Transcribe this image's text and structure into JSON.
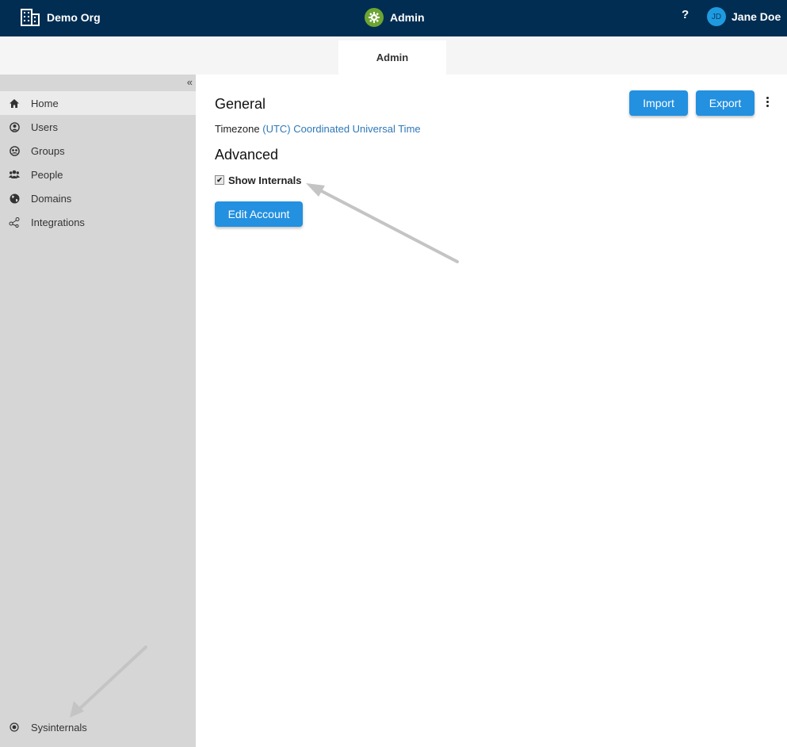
{
  "topbar": {
    "org_name": "Demo Org",
    "app_name": "Admin",
    "help_label": "?",
    "user_initials": "JD",
    "user_name": "Jane Doe"
  },
  "tabs": [
    {
      "label": "Admin"
    }
  ],
  "sidebar": {
    "collapse_label": "«",
    "items": [
      {
        "label": "Home",
        "icon": "home-icon"
      },
      {
        "label": "Users",
        "icon": "user-circle-icon"
      },
      {
        "label": "Groups",
        "icon": "group-circle-icon"
      },
      {
        "label": "People",
        "icon": "people-icon"
      },
      {
        "label": "Domains",
        "icon": "globe-icon"
      },
      {
        "label": "Integrations",
        "icon": "share-nodes-icon"
      }
    ],
    "footer_item": {
      "label": "Sysinternals",
      "icon": "target-icon"
    }
  },
  "main": {
    "general_heading": "General",
    "timezone_label": "Timezone",
    "timezone_value": "(UTC) Coordinated Universal Time",
    "advanced_heading": "Advanced",
    "show_internals_label": "Show Internals",
    "show_internals_checked": true,
    "edit_account_label": "Edit Account"
  },
  "toolbar": {
    "import_label": "Import",
    "export_label": "Export"
  },
  "colors": {
    "topbar_bg": "#022d52",
    "accent_button": "#2390e0",
    "link": "#2e78b7",
    "gear_green": "#6da532",
    "sidebar_bg": "#d6d6d6"
  }
}
